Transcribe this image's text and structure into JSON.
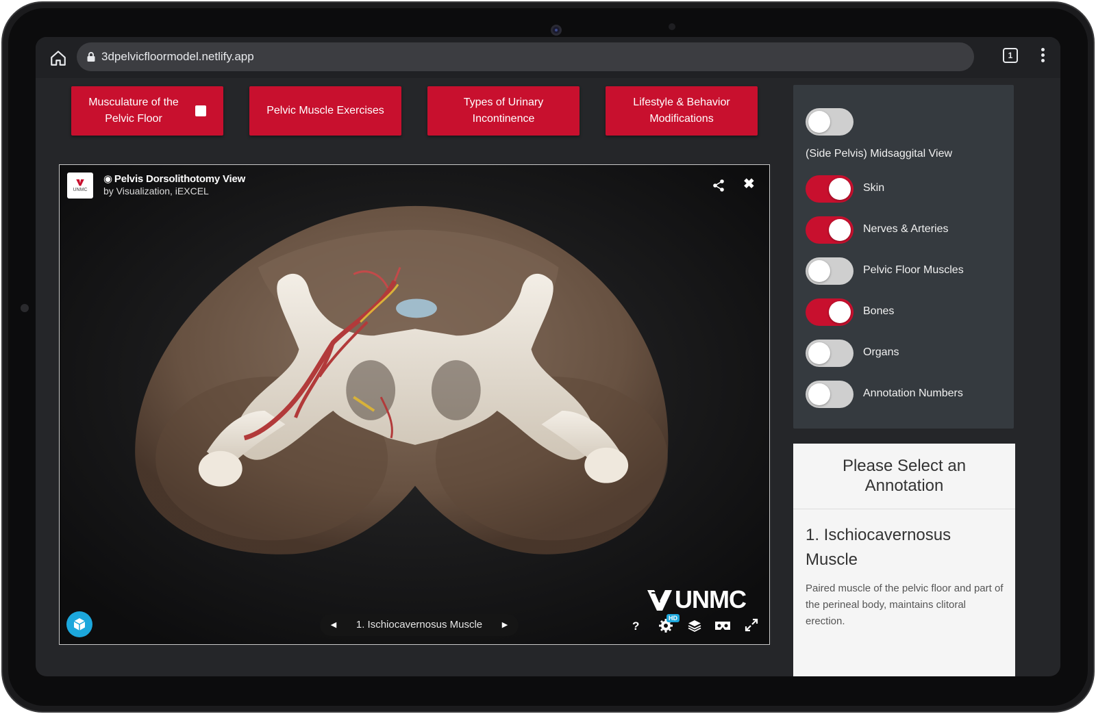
{
  "browser": {
    "url": "3dpelvicfloormodel.netlify.app",
    "tab_count": "1"
  },
  "nav": {
    "buttons": [
      {
        "label_line1": "Musculature of the",
        "label_line2": "Pelvic Floor"
      },
      {
        "label": "Pelvic Muscle Exercises"
      },
      {
        "label_line1": "Types of Urinary",
        "label_line2": "Incontinence"
      },
      {
        "label_line1": "Lifestyle & Behavior",
        "label_line2": "Modifications"
      }
    ]
  },
  "viewer": {
    "title": "Pelvis Dorsolithotomy View",
    "byline": "by Visualization, iEXCEL",
    "logo_text": "UNMC",
    "watermark": "UNMC",
    "annotation_current": "1. Ischiocavernosus Muscle",
    "help_label": "?",
    "hd_badge": "HD"
  },
  "toggles": {
    "view_label": "(Side Pelvis) Midsaggital View",
    "view_on": false,
    "items": [
      {
        "label": "Skin",
        "on": true
      },
      {
        "label": "Nerves & Arteries",
        "on": true
      },
      {
        "label": "Pelvic Floor Muscles",
        "on": false
      },
      {
        "label": "Bones",
        "on": true
      },
      {
        "label": "Organs",
        "on": false
      },
      {
        "label": "Annotation Numbers",
        "on": false
      }
    ]
  },
  "annotation_panel": {
    "heading_line1": "Please Select an",
    "heading_line2": "Annotation",
    "title_line1": "1. Ischiocavernosus",
    "title_line2": "Muscle",
    "description": "Paired muscle of the pelvic floor and part of the perineal body, maintains clitoral erection."
  },
  "colors": {
    "accent": "#c8102e",
    "panel": "#353a3f",
    "viewer_bg": "#0e0e0f"
  }
}
